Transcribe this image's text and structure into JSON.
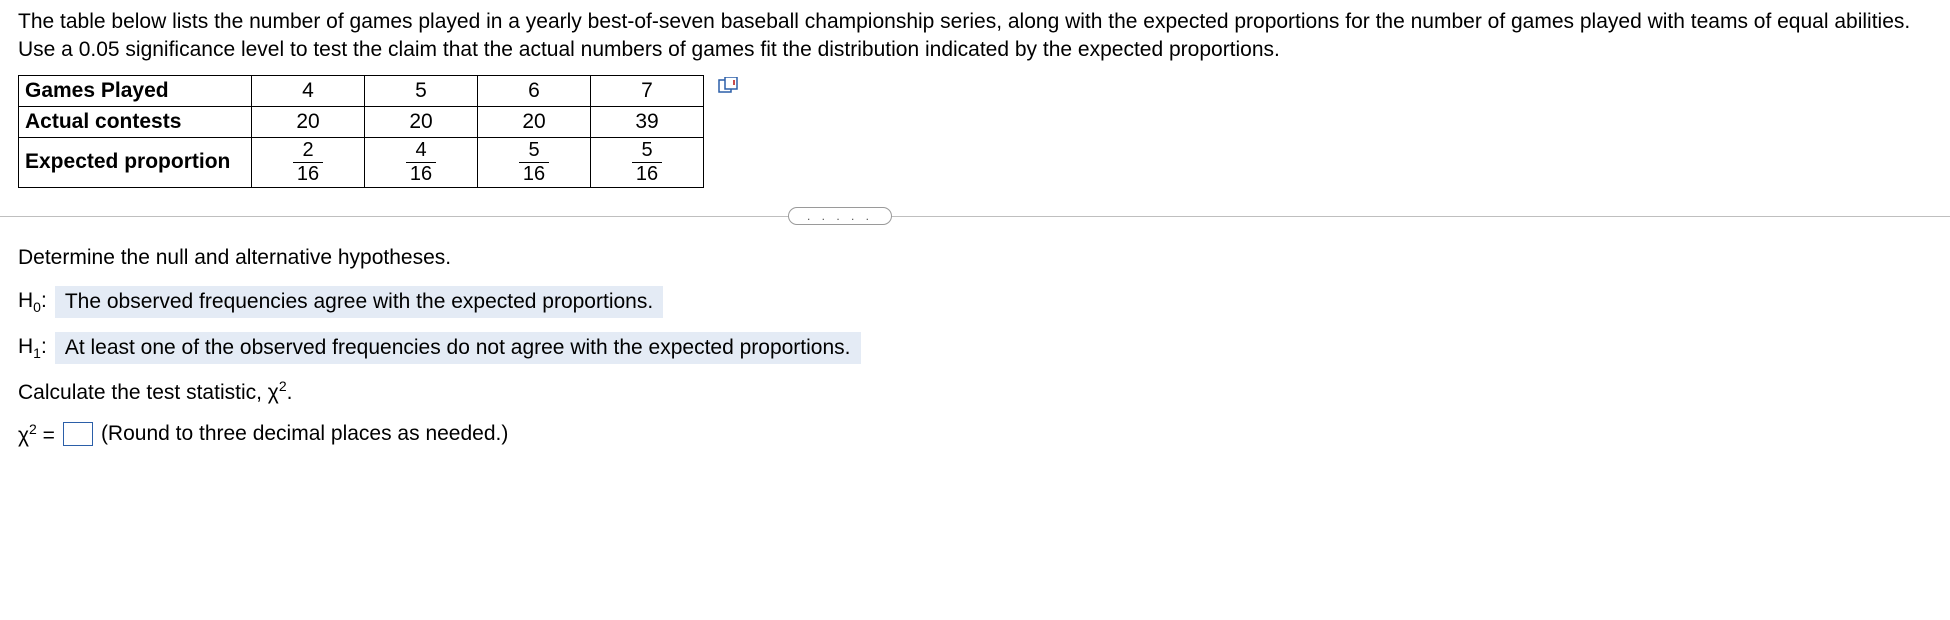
{
  "intro": "The table below lists the number of games played in a yearly best-of-seven baseball championship series, along with the expected proportions for the number of games played with teams of equal abilities. Use a 0.05 significance level to test the claim that the actual numbers of games fit the distribution indicated by the expected proportions.",
  "table": {
    "row1_label": "Games Played",
    "row2_label": "Actual contests",
    "row3_label": "Expected proportion",
    "games": [
      "4",
      "5",
      "6",
      "7"
    ],
    "actual": [
      "20",
      "20",
      "20",
      "39"
    ],
    "expected_num": [
      "2",
      "4",
      "5",
      "5"
    ],
    "expected_den": [
      "16",
      "16",
      "16",
      "16"
    ]
  },
  "divider_dots": ". . . . .",
  "prompt_hypotheses": "Determine the null and alternative hypotheses.",
  "h0_label": "H",
  "h0_sub": "0",
  "h0_colon": ":",
  "h0_answer": "The observed frequencies agree with the expected proportions.",
  "h1_label": "H",
  "h1_sub": "1",
  "h1_colon": ":",
  "h1_answer": "At least one of the observed frequencies do not agree with the expected proportions.",
  "calc_prompt_prefix": "Calculate the test statistic, ",
  "chi": "χ",
  "sq": "2",
  "period": ".",
  "chisq_eq": " = ",
  "hint": "(Round to three decimal places as needed.)",
  "chart_data": {
    "type": "table",
    "title": "Best-of-seven championship series goodness-of-fit data",
    "significance_level": 0.05,
    "categories": [
      "4",
      "5",
      "6",
      "7"
    ],
    "series": [
      {
        "name": "Actual contests",
        "values": [
          20,
          20,
          20,
          39
        ]
      },
      {
        "name": "Expected proportion",
        "values": [
          0.125,
          0.25,
          0.3125,
          0.3125
        ]
      }
    ]
  }
}
